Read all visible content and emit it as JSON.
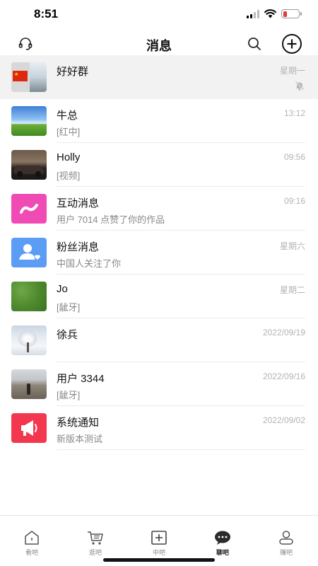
{
  "status_bar": {
    "time": "8:51"
  },
  "header": {
    "title": "消息"
  },
  "chats": [
    {
      "name": "好好群",
      "preview": "",
      "time": "星期一",
      "muted": true,
      "pinned": true,
      "avatar": "group-flag-photo"
    },
    {
      "name": "牛总",
      "preview": "[红中]",
      "time": "13:12",
      "avatar": "sky-meadow-photo"
    },
    {
      "name": "Holly",
      "preview": "[视频]",
      "time": "09:56",
      "avatar": "car-photo"
    },
    {
      "name": "互动消息",
      "preview": "用户 7014 点赞了你的作品",
      "time": "09:16",
      "avatar": "interaction-icon"
    },
    {
      "name": "粉丝消息",
      "preview": "中国人关注了你",
      "time": "星期六",
      "avatar": "fans-icon"
    },
    {
      "name": "Jo",
      "preview": "[龇牙]",
      "time": "星期二",
      "avatar": "grass-photo"
    },
    {
      "name": "徐兵",
      "preview": "",
      "time": "2022/09/19",
      "avatar": "snow-tree-photo"
    },
    {
      "name": "用户 3344",
      "preview": "[龇牙]",
      "time": "2022/09/16",
      "avatar": "great-wall-photo"
    },
    {
      "name": "系统通知",
      "preview": "新版本测试",
      "time": "2022/09/02",
      "avatar": "megaphone-icon"
    }
  ],
  "tabs": [
    {
      "label": "看吧",
      "icon": "home-icon"
    },
    {
      "label": "逛吧",
      "icon": "cart-icon"
    },
    {
      "label": "中吧",
      "icon": "plus-square-icon"
    },
    {
      "label": "聊吧",
      "icon": "chat-bubble-icon",
      "active": true
    },
    {
      "label": "赚吧",
      "icon": "profile-icon"
    }
  ],
  "colors": {
    "interaction": "#f04bb5",
    "fans": "#5b9cf5",
    "system": "#f2374f",
    "battery_low": "#e53935"
  }
}
